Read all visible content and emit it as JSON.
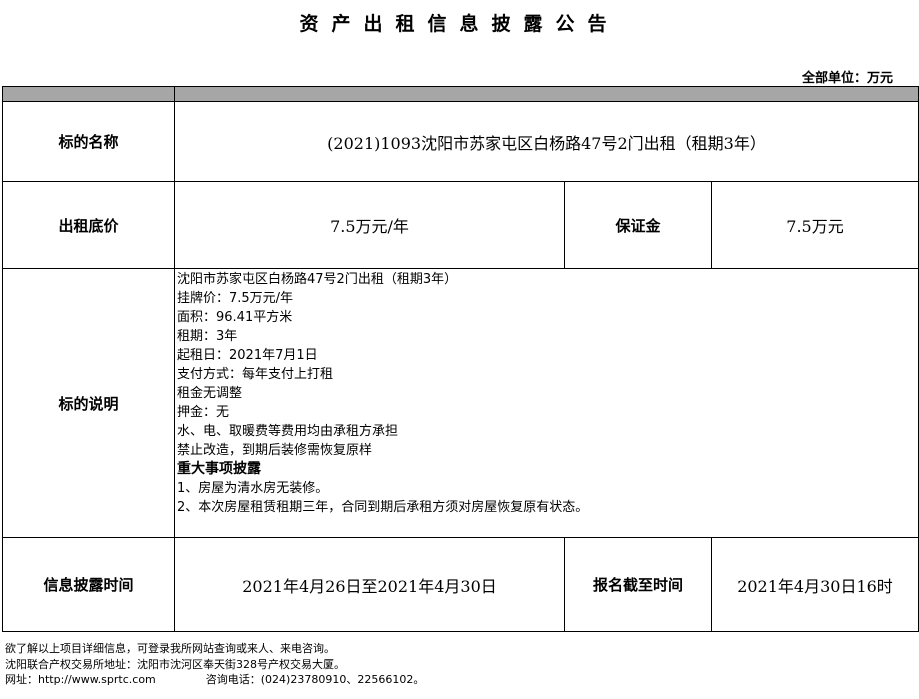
{
  "header": {
    "title": "资产出租信息披露公告",
    "unit": "全部单位：万元"
  },
  "table": {
    "name_label": "标的名称",
    "name_value": "(2021)1093沈阳市苏家屯区白杨路47号2门出租（租期3年）",
    "price_label": "出租底价",
    "price_value": "7.5万元/年",
    "deposit_label": "保证金",
    "deposit_value": "7.5万元",
    "desc_label": "标的说明",
    "desc_lines": [
      "沈阳市苏家屯区白杨路47号2门出租（租期3年）",
      "挂牌价：7.5万元/年",
      "面积：96.41平方米",
      "租期：3年",
      "起租日：2021年7月1日",
      "支付方式：每年支付上打租",
      "租金无调整",
      "押金：无",
      "水、电、取暖费等费用均由承租方承担",
      "禁止改造，到期后装修需恢复原样"
    ],
    "major_heading": "重大事项披露",
    "major_lines": [
      "1、房屋为清水房无装修。",
      "2、本次房屋租赁租期三年，合同到期后承租方须对房屋恢复原有状态。"
    ],
    "time_label": "信息披露时间",
    "time_value": "2021年4月26日至2021年4月30日",
    "deadline_label": "报名截至时间",
    "deadline_value": "2021年4月30日16时"
  },
  "footer": {
    "line1": "欲了解以上项目详细信息，可登录我所网站查询或来人、来电咨询。",
    "line2": "沈阳联合产权交易所地址：沈阳市沈河区奉天街328号产权交易大厦。",
    "website": "网址：http://www.sprtc.com",
    "phone": "咨询电话：(024)23780910、22566102。"
  }
}
